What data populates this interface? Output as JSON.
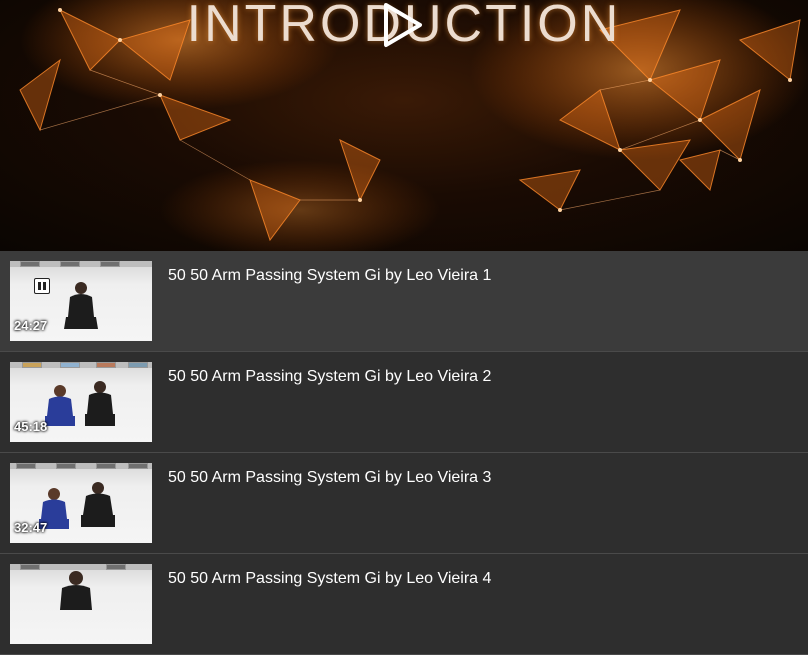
{
  "hero": {
    "title": "INTRODUCTION",
    "accent_color": "#ff7a1a",
    "play_icon": "play-icon"
  },
  "playlist": {
    "items": [
      {
        "title": "50 50 Arm Passing System Gi by Leo Vieira 1",
        "duration": "24:27",
        "state": "playing"
      },
      {
        "title": "50 50 Arm Passing System Gi by Leo Vieira 2",
        "duration": "45:18",
        "state": "idle"
      },
      {
        "title": "50 50 Arm Passing System Gi by Leo Vieira 3",
        "duration": "32:47",
        "state": "idle"
      },
      {
        "title": "50 50 Arm Passing System Gi by Leo Vieira 4",
        "duration": "",
        "state": "idle"
      }
    ]
  }
}
